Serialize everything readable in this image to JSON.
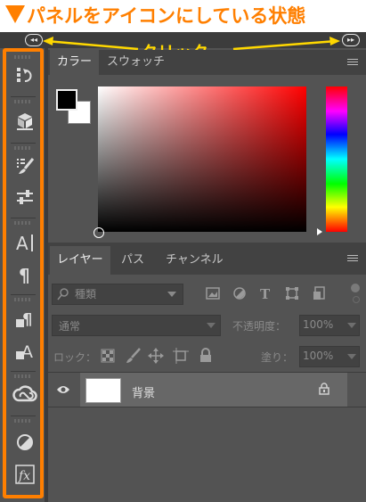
{
  "heading": {
    "text": "パネルをアイコンにしている状態"
  },
  "annotation": {
    "callout": "クリック",
    "left_toggle": "◂◂",
    "right_toggle": "▸▸"
  },
  "dock": {
    "icons": [
      "history-icon",
      "properties-3d-icon",
      "brush-settings-icon",
      "brush-icon",
      "character-icon",
      "paragraph-icon",
      "character-style-icon",
      "paragraph-style-icon",
      "creative-cloud-icon",
      "adjustments-icon",
      "styles-fx-icon"
    ]
  },
  "color_panel": {
    "tabs": [
      {
        "label": "カラー",
        "active": true
      },
      {
        "label": "スウォッチ",
        "active": false
      }
    ]
  },
  "layers_panel": {
    "tabs": [
      {
        "label": "レイヤー",
        "active": true
      },
      {
        "label": "パス",
        "active": false
      },
      {
        "label": "チャンネル",
        "active": false
      }
    ],
    "filter_label": "種類",
    "blend_mode": "通常",
    "opacity_label": "不透明度：",
    "opacity_value": "100%",
    "lock_label": "ロック：",
    "fill_label": "塗り：",
    "fill_value": "100%",
    "layer": {
      "name": "背景"
    }
  },
  "colors": {
    "accent": "#ff7f00",
    "callout": "#ffd800",
    "panel_bg": "#535353",
    "dark_bg": "#3c3c3c"
  }
}
